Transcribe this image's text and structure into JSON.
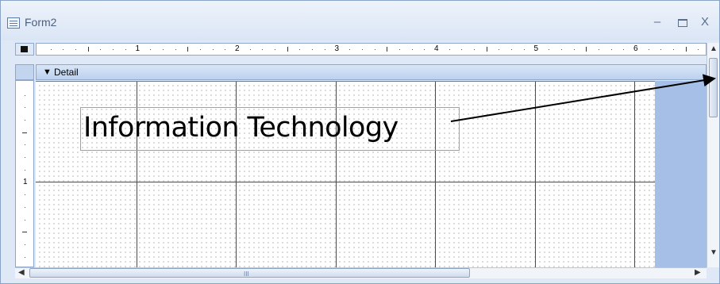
{
  "window": {
    "title": "Form2"
  },
  "controls": {
    "minimize": "–",
    "maximize": "▭",
    "close": "X"
  },
  "ruler": {
    "horizontal_numbers": [
      "1",
      "2",
      "3",
      "4",
      "5",
      "6"
    ],
    "vertical_numbers": [
      "1"
    ]
  },
  "section": {
    "label": "Detail"
  },
  "form": {
    "label_text": "Information Technology"
  },
  "scrollbars": {
    "grip": "III"
  },
  "icons": {
    "form": "form-icon",
    "collapse": "chevron-icon",
    "arrow_up": "arrow-up-icon",
    "arrow_down": "arrow-down-icon",
    "arrow_left": "arrow-left-icon",
    "arrow_right": "arrow-right-icon"
  }
}
